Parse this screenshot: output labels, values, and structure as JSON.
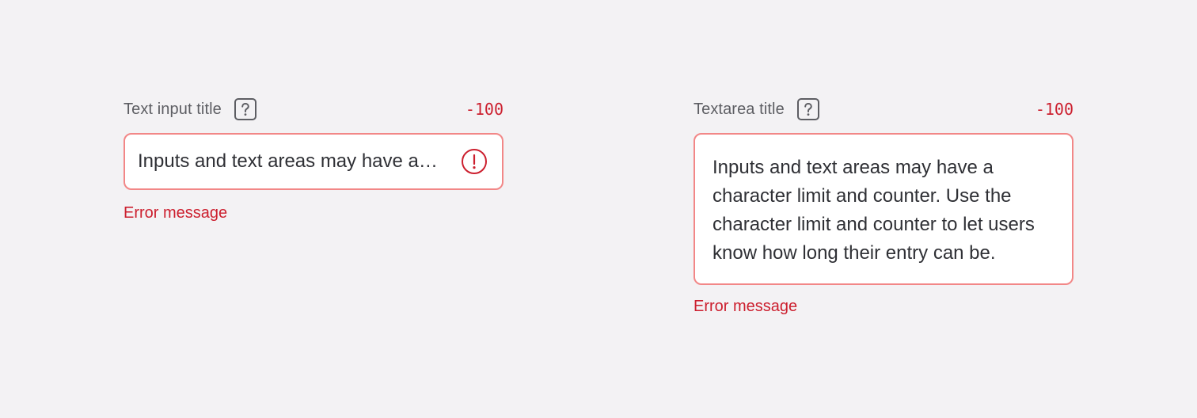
{
  "colors": {
    "background": "#f3f2f4",
    "error": "#cc1f2e",
    "error_border": "#f28787",
    "label": "#5d5e63",
    "text": "#2f3035"
  },
  "text_input": {
    "title": "Text input title",
    "help_icon": "help-icon",
    "counter": "-100",
    "value": "Inputs and text areas may have a character limit and counter. Use the character limit and counter to let users know how long their entry can be.",
    "status_icon": "error-icon",
    "error_message": "Error message"
  },
  "textarea": {
    "title": "Textarea title",
    "help_icon": "help-icon",
    "counter": "-100",
    "value": "Inputs and text areas may have a character limit and counter. Use the character limit and counter to let users know how long their entry can be.",
    "error_message": "Error message"
  }
}
